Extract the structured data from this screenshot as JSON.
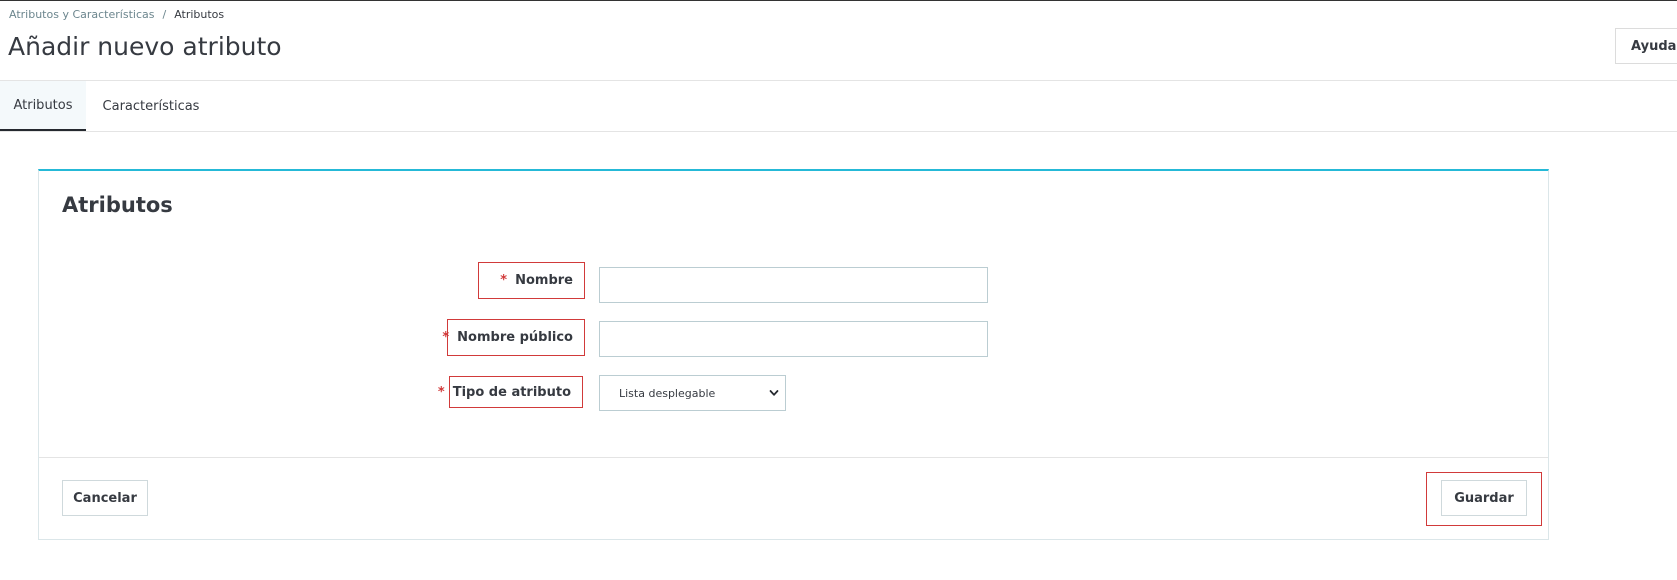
{
  "breadcrumb": {
    "parent": "Atributos y Características",
    "separator": "/",
    "current": "Atributos"
  },
  "header": {
    "title": "Añadir nuevo atributo",
    "help_label": "Ayuda"
  },
  "tabs": [
    {
      "label": "Atributos",
      "active": true
    },
    {
      "label": "Características",
      "active": false
    }
  ],
  "form": {
    "card_title": "Atributos",
    "fields": {
      "name": {
        "label": "Nombre",
        "required_mark": "*",
        "value": ""
      },
      "public_name": {
        "label": "Nombre público",
        "required_mark": "*",
        "value": ""
      },
      "attribute_type": {
        "label": "Tipo de atributo",
        "required_mark": "*",
        "selected": "Lista desplegable"
      }
    },
    "cancel_label": "Cancelar",
    "save_label": "Guardar"
  },
  "colors": {
    "accent": "#25b9d7",
    "required": "#d13a3a",
    "text": "#363a41",
    "muted": "#6c868e"
  }
}
